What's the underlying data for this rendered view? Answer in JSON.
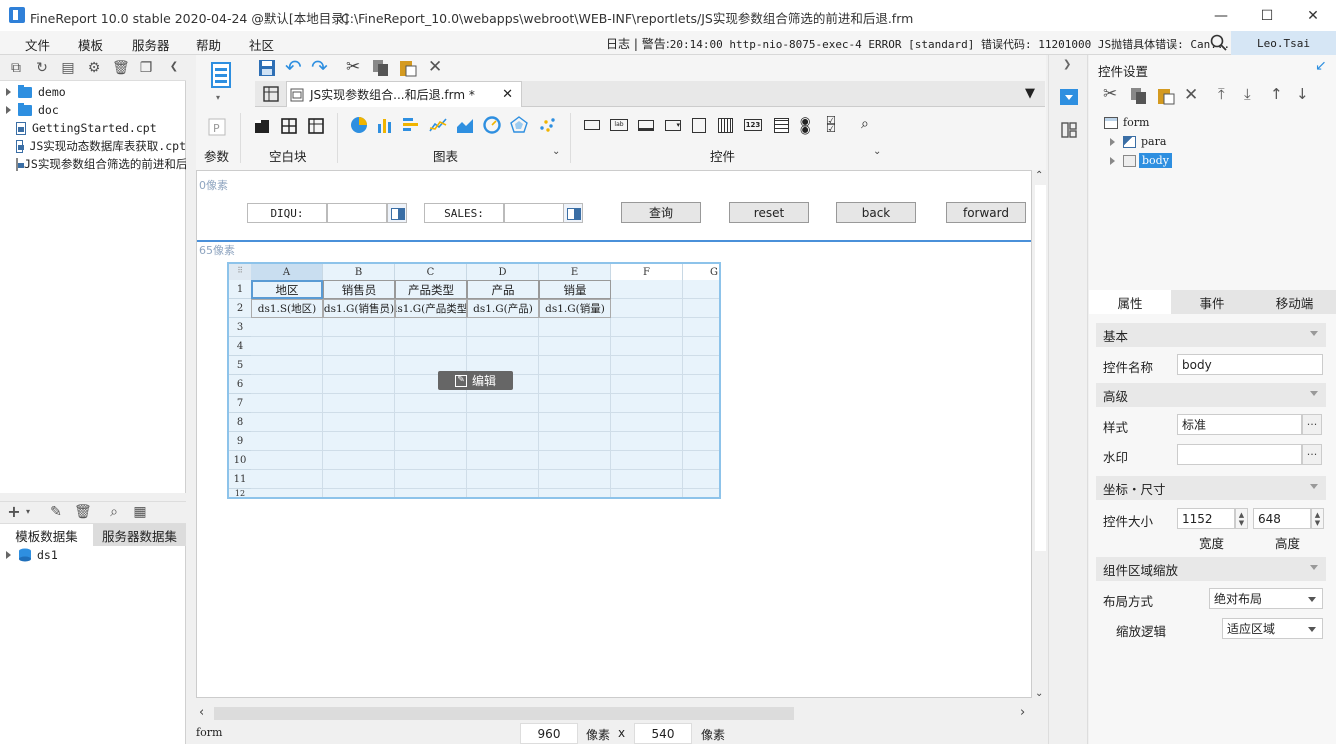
{
  "window": {
    "title": "FineReport 10.0 stable 2020-04-24 @默认[本地目录]",
    "path": "C:\\FineReport_10.0\\webapps\\webroot\\WEB-INF\\reportlets/JS实现参数组合筛选的前进和后退.frm"
  },
  "menu": [
    "文件",
    "模板",
    "服务器",
    "帮助",
    "社区"
  ],
  "log": {
    "label": "日志",
    "warning": "警告:",
    "message": "20:14:00 http-nio-8075-exec-4 ERROR [standard] 错误代码: 11201000 JS抛错具体错误: Can..."
  },
  "user": "Leo.Tsai",
  "file_tree": [
    {
      "type": "folder",
      "name": "demo"
    },
    {
      "type": "folder",
      "name": "doc"
    },
    {
      "type": "file",
      "name": "GettingStarted.cpt"
    },
    {
      "type": "file",
      "name": "JS实现动态数据库表获取.cpt"
    },
    {
      "type": "file",
      "name": "JS实现参数组合筛选的前进和后退.frm"
    }
  ],
  "dataset_tabs": [
    "模板数据集",
    "服务器数据集"
  ],
  "datasets": [
    "ds1"
  ],
  "tab": {
    "label": "JS实现参数组合...和后退.frm *"
  },
  "toolbar_groups": {
    "param": "参数",
    "blank": "空白块",
    "chart": "图表",
    "widget": "控件"
  },
  "canvas": {
    "param_px": "0像素",
    "body_px": "65像素",
    "params": [
      {
        "label": "DIQU:"
      },
      {
        "label": "SALES:"
      }
    ],
    "buttons": [
      "查询",
      "reset",
      "back",
      "forward"
    ],
    "grid": {
      "columns": [
        "A",
        "B",
        "C",
        "D",
        "E",
        "F",
        "G"
      ],
      "rows": [
        "1",
        "2",
        "3",
        "4",
        "5",
        "6",
        "7",
        "8",
        "9",
        "10",
        "11",
        "12"
      ],
      "header_row": [
        "地区",
        "销售员",
        "产品类型",
        "产品",
        "销量"
      ],
      "data_row": [
        "ds1.S(地区)",
        "ds1.G(销售员)",
        "ds1.G(产品类型)",
        "ds1.G(产品)",
        "ds1.G(销量)"
      ]
    },
    "edit_label": "编辑"
  },
  "status": {
    "left": "form",
    "width": "960",
    "unit1": "像素",
    "x": "x",
    "height": "540",
    "unit2": "像素"
  },
  "right": {
    "title": "控件设置",
    "tree": {
      "root": "form",
      "children": [
        "para",
        "body"
      ]
    },
    "tabs": [
      "属性",
      "事件",
      "移动端"
    ],
    "sections": {
      "basic": "基本",
      "advanced": "高级",
      "coords": "坐标・尺寸",
      "scale": "组件区域缩放"
    },
    "props": {
      "name_label": "控件名称",
      "name_value": "body",
      "style_label": "样式",
      "style_value": "标准",
      "watermark_label": "水印",
      "size_label": "控件大小",
      "width_value": "1152",
      "height_value": "648",
      "width_label": "宽度",
      "height_label": "高度",
      "layout_label": "布局方式",
      "layout_value": "绝对布局",
      "scale_label": "缩放逻辑",
      "scale_value": "适应区域"
    }
  }
}
